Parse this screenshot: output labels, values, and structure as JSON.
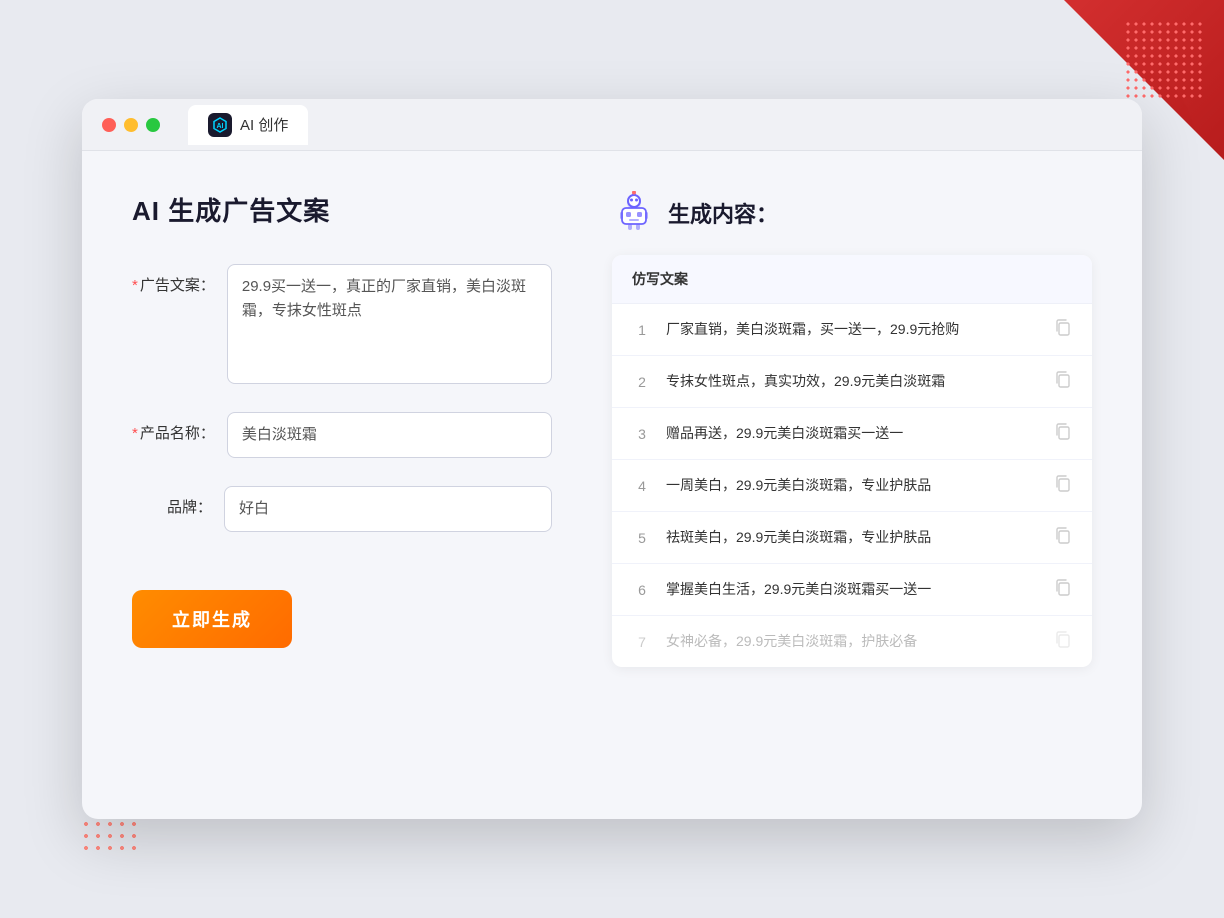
{
  "background": {
    "color": "#e8eaf0"
  },
  "tab": {
    "label": "AI 创作",
    "icon_text": "AI"
  },
  "left_panel": {
    "title": "AI 生成广告文案",
    "form": {
      "ad_copy_label": "广告文案：",
      "ad_copy_required": "*",
      "ad_copy_value": "29.9买一送一，真正的厂家直销，美白淡斑霜，专抹女性斑点",
      "product_name_label": "产品名称：",
      "product_name_required": "*",
      "product_name_value": "美白淡斑霜",
      "brand_label": "品牌：",
      "brand_value": "好白"
    },
    "generate_button": "立即生成"
  },
  "right_panel": {
    "title": "生成内容：",
    "table_header": "仿写文案",
    "results": [
      {
        "id": 1,
        "text": "厂家直销，美白淡斑霜，买一送一，29.9元抢购",
        "dimmed": false
      },
      {
        "id": 2,
        "text": "专抹女性斑点，真实功效，29.9元美白淡斑霜",
        "dimmed": false
      },
      {
        "id": 3,
        "text": "赠品再送，29.9元美白淡斑霜买一送一",
        "dimmed": false
      },
      {
        "id": 4,
        "text": "一周美白，29.9元美白淡斑霜，专业护肤品",
        "dimmed": false
      },
      {
        "id": 5,
        "text": "祛斑美白，29.9元美白淡斑霜，专业护肤品",
        "dimmed": false
      },
      {
        "id": 6,
        "text": "掌握美白生活，29.9元美白淡斑霜买一送一",
        "dimmed": false
      },
      {
        "id": 7,
        "text": "女神必备，29.9元美白淡斑霜，护肤必备",
        "dimmed": true
      }
    ]
  }
}
